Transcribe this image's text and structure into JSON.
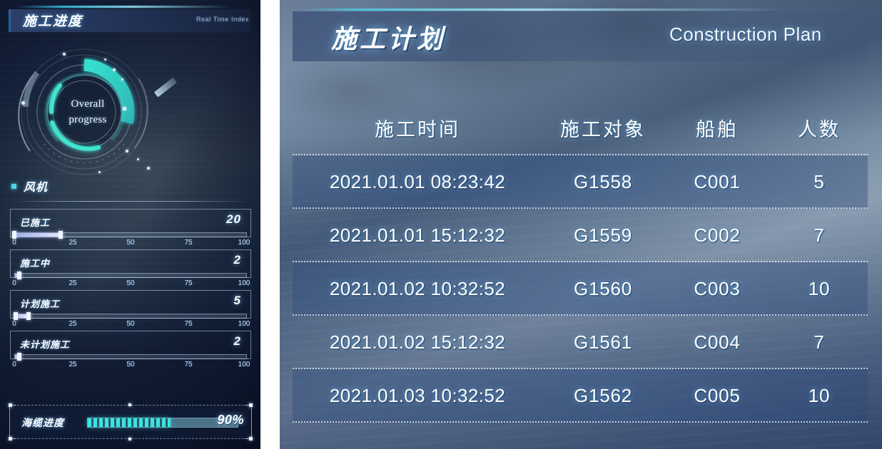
{
  "left": {
    "title": "施工进度",
    "subtitle": "Real Time Index",
    "gauge": {
      "line1": "Overall",
      "line2": "progress"
    },
    "section": {
      "label": "风机",
      "bullet": "square-bullet"
    },
    "axis_ticks": [
      "0",
      "25",
      "50",
      "75",
      "100"
    ],
    "metrics": [
      {
        "name": "已施工",
        "value": "20",
        "percent": 20
      },
      {
        "name": "施工中",
        "value": "2",
        "percent": 2
      },
      {
        "name": "计划施工",
        "value": "5",
        "percent": 5
      },
      {
        "name": "未计划施工",
        "value": "2",
        "percent": 2
      }
    ],
    "cable": {
      "name": "海缆进度",
      "value": "90%",
      "percent": 90
    }
  },
  "right": {
    "title": "施工计划",
    "subtitle": "Construction Plan",
    "columns": [
      "施工时间",
      "施工对象",
      "船舶",
      "人数"
    ],
    "rows": [
      {
        "time": "2021.01.01 08:23:42",
        "object": "G1558",
        "ship": "C001",
        "people": "5"
      },
      {
        "time": "2021.01.01 15:12:32",
        "object": "G1559",
        "ship": "C002",
        "people": "7"
      },
      {
        "time": "2021.01.02 10:32:52",
        "object": "G1560",
        "ship": "C003",
        "people": "10"
      },
      {
        "time": "2021.01.02 15:12:32",
        "object": "G1561",
        "ship": "C004",
        "people": "7"
      },
      {
        "time": "2021.01.03 10:32:52",
        "object": "G1562",
        "ship": "C005",
        "people": "10"
      }
    ]
  },
  "colors": {
    "accent_cyan": "#4fd3e6",
    "panel_navy": "#172a4e",
    "fill_lavender": "#c7cdf2",
    "row_highlight": "#2e4c7c",
    "text_white": "#ffffff"
  }
}
